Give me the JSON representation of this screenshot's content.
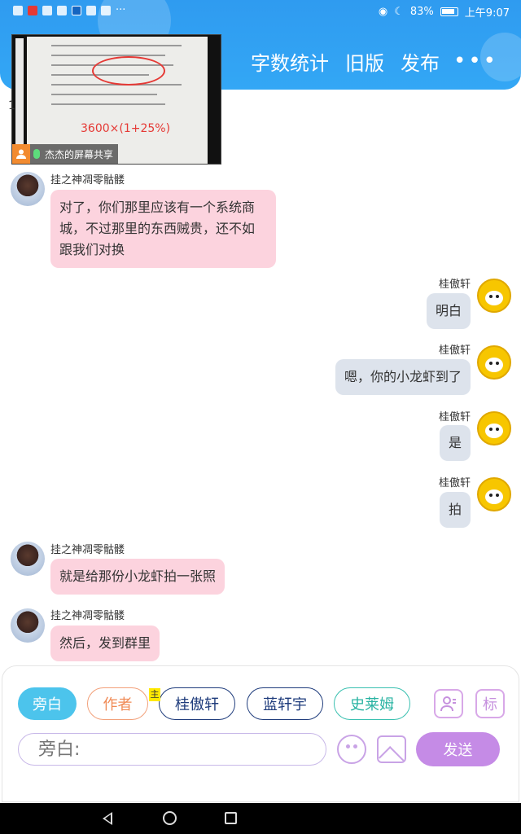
{
  "status_bar": {
    "battery": "83%",
    "time": "上午9:07"
  },
  "header": {
    "actions": [
      "字数统计",
      "旧版",
      "发布"
    ],
    "more": "•••"
  },
  "screen_share": {
    "label": "杰杰的屏幕共享",
    "handwriting": "3600×(1+25%)"
  },
  "side_mark": "1",
  "messages": [
    {
      "sender": "挂之神凋零骷髅",
      "text": "对了，你们那里应该有一个系统商城，不过那里的东西贼贵，还不如跟我们对换",
      "side": "left"
    },
    {
      "sender": "桂傲轩",
      "text": "明白",
      "side": "right"
    },
    {
      "sender": "桂傲轩",
      "text": "嗯，你的小龙虾到了",
      "side": "right"
    },
    {
      "sender": "桂傲轩",
      "text": "是",
      "side": "right"
    },
    {
      "sender": "桂傲轩",
      "text": "拍",
      "side": "right"
    },
    {
      "sender": "挂之神凋零骷髅",
      "text": "就是给那份小龙虾拍一张照",
      "side": "left"
    },
    {
      "sender": "挂之神凋零骷髅",
      "text": "然后，发到群里",
      "side": "left"
    }
  ],
  "roles": {
    "narrator": "旁白",
    "author": "作者",
    "main_tag": "主",
    "char1": "桂傲轩",
    "char2": "蓝轩宇",
    "char3": "史莱姆"
  },
  "tools": {
    "mark_label": "标"
  },
  "composer": {
    "placeholder": "旁白:",
    "send_label": "发送"
  }
}
